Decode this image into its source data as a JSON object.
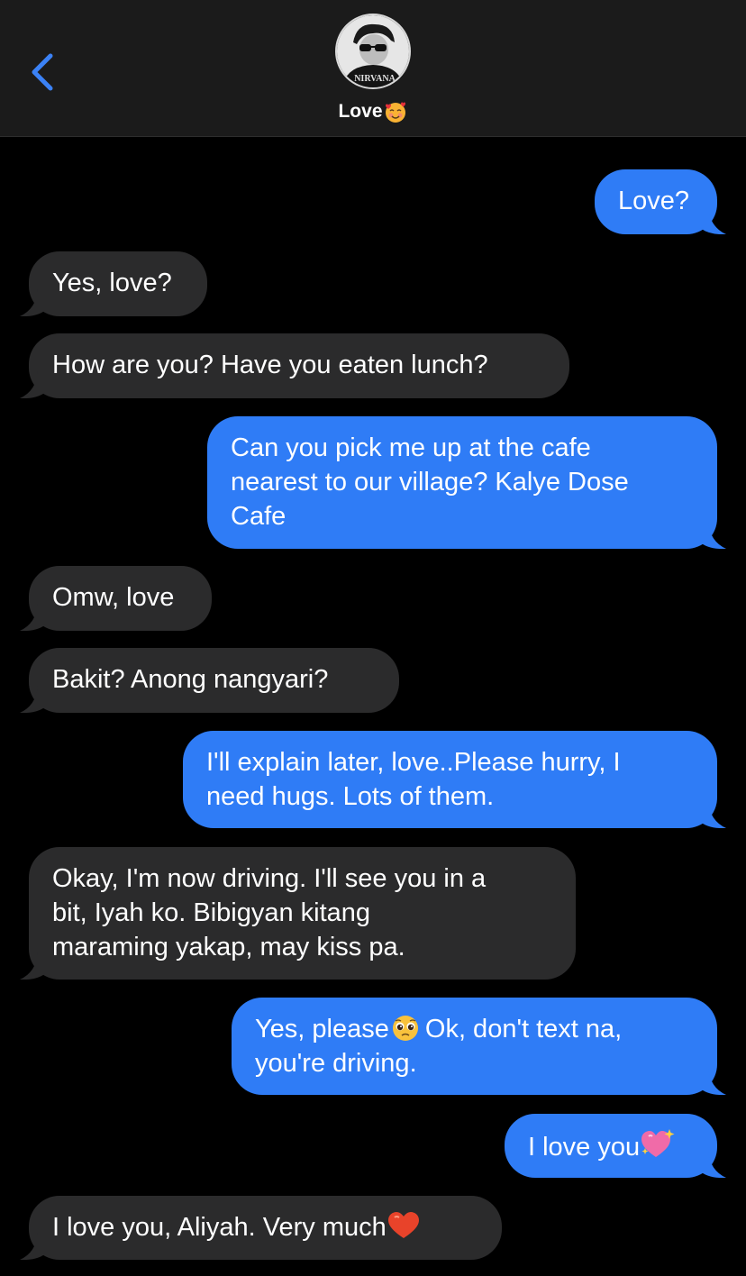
{
  "header": {
    "contact_name": "Love",
    "contact_emoji": "smiling-face-with-hearts-emoji",
    "avatar_shirt_text": "NIRVANA",
    "back_icon": "chevron-left-icon"
  },
  "colors": {
    "header_bg": "#1b1b1b",
    "background": "#000000",
    "outgoing_bubble": "#2f7cf6",
    "incoming_bubble": "#2b2b2c",
    "accent_blue": "#3b82f6",
    "text": "#ffffff"
  },
  "messages": [
    {
      "direction": "outgoing",
      "lines": [
        "Love?"
      ]
    },
    {
      "direction": "incoming",
      "lines": [
        "Yes, love?"
      ]
    },
    {
      "direction": "incoming",
      "lines": [
        "How are you? Have you eaten lunch?"
      ]
    },
    {
      "direction": "outgoing",
      "lines": [
        "Can you pick me up at the cafe",
        "nearest to our village? Kalye Dose",
        "Cafe"
      ]
    },
    {
      "direction": "incoming",
      "lines": [
        "Omw, love"
      ]
    },
    {
      "direction": "incoming",
      "lines": [
        "Bakit? Anong nangyari?"
      ]
    },
    {
      "direction": "outgoing",
      "lines": [
        "I'll explain later, love..Please hurry, I",
        "need hugs. Lots of them."
      ]
    },
    {
      "direction": "incoming",
      "lines": [
        "Okay, I'm now driving. I'll see you in a",
        "bit, Iyah ko. Bibigyan kitang",
        "maraming yakap, may kiss pa."
      ]
    },
    {
      "direction": "outgoing",
      "lines": [
        "Yes, please",
        "Ok, don't text na,",
        "you're driving."
      ],
      "emoji": "pleading-face-emoji"
    },
    {
      "direction": "outgoing",
      "lines": [
        "I love you"
      ],
      "emoji": "sparkling-heart-emoji"
    },
    {
      "direction": "incoming",
      "lines": [
        "I love you, Aliyah. Very much"
      ],
      "emoji": "red-heart-emoji"
    }
  ]
}
